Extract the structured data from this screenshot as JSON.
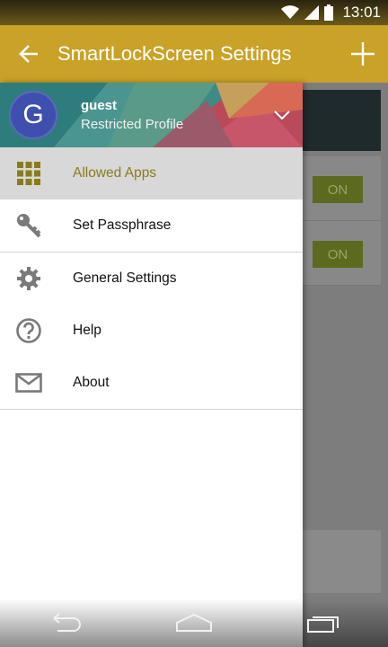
{
  "status_bar": {
    "time": "13:01"
  },
  "app_bar": {
    "title": "SmartLockScreen Settings"
  },
  "account": {
    "avatar_letter": "G",
    "name": "guest",
    "profile": "Restricted Profile"
  },
  "drawer": {
    "items": [
      {
        "label": "Allowed Apps",
        "icon": "grid-icon",
        "selected": true
      },
      {
        "label": "Set Passphrase",
        "icon": "key-icon",
        "selected": false
      },
      {
        "label": "General Settings",
        "icon": "gear-icon",
        "selected": false
      },
      {
        "label": "Help",
        "icon": "help-icon",
        "selected": false
      },
      {
        "label": "About",
        "icon": "mail-icon",
        "selected": false
      }
    ]
  },
  "background": {
    "toggle_1": "ON",
    "toggle_2": "ON"
  },
  "colors": {
    "accent": "#c9a227",
    "selected_text": "#8a7a1c",
    "avatar": "#3f4fae"
  }
}
